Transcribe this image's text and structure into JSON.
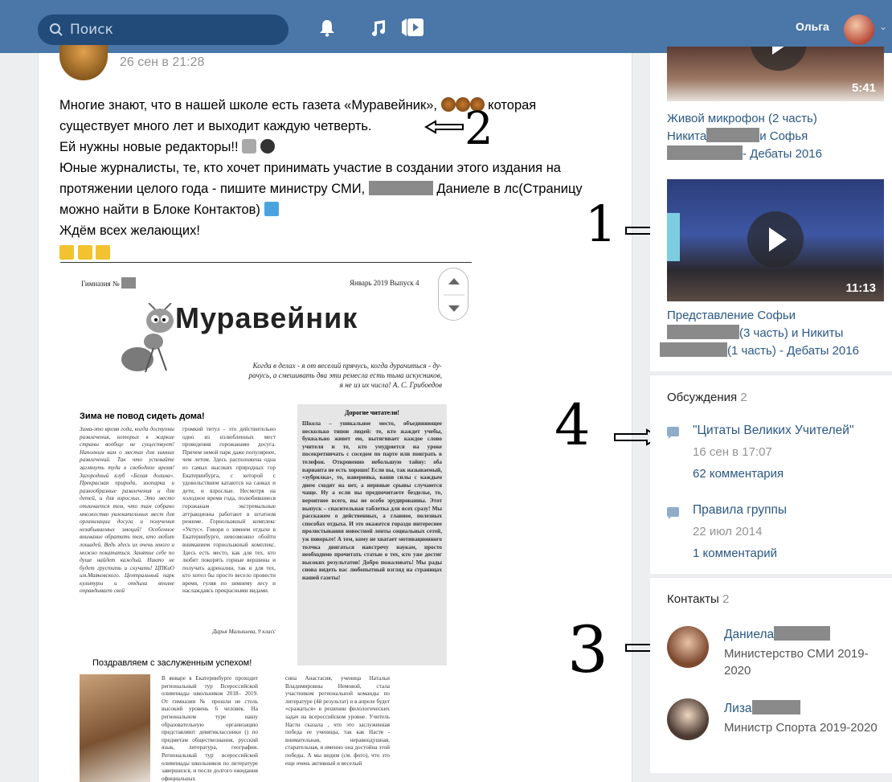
{
  "topbar": {
    "search_placeholder": "Поиск",
    "user_name": "Ольга"
  },
  "post": {
    "date": "26 сен в 21:28",
    "line1_a": "Многие знают, что в нашей школе есть газета «Муравейник»,",
    "line1_b": "которая",
    "line2": "существует много лет и выходит каждую четверть.",
    "line3": "Ей нужны новые редакторы!!",
    "line4": "Юные журналисты, те, кто хочет принимать участие в создании этого издания на",
    "line5_a": "протяжении целого года - пишите министру СМИ,",
    "line5_b": "Даниеле в лс(Страницу",
    "line6": "можно найти в Блоке Контактов)",
    "line7": "Ждём всех желающих!"
  },
  "newspaper": {
    "school": "Гимназия №",
    "issue": "Январь 2019 Выпуск 4",
    "title": "Муравейник",
    "motto1": "Когда в делах - я от веселий прячусь, когда дурачиться - ду-",
    "motto2": "рачусь, а смешивать два эти ремесла есть тьма искусников,",
    "motto3": "я не из их числа! А. С. Грибоедов",
    "article_title": "Зима не повод сидеть дома!",
    "article_col1": "Зима-это время года, когда доступны развлечения, которых в жаркие страны вообще не существует! Наполним вам о местах для зимних развлечений. Так что успевайте заглянуть туда в свободное время! Загородный клуб «Белая долина». Прекрасная природа, зоопарка и разнообразные развлечения и для детей, и для взрослых. Это место отличается тем, что там собрано множество увлекательных мест для организации досуга и получения незабываемых эмоций! Особенное внимание обратить тем, кто любит лошадей. Ведь здесь их очень много и можно покататься. Занятие себе по душе найдет каждый. Никто не будет грустить и скучать! ЦПКиО им.Маяковского. Центральный парк культуры и отдыха вполне оправдывает свой",
    "article_col2": "громкий титул – это действительно одно из излюбленных мест проведения горожанами досуга. Причем зимой парк даже популярнее, чем летом. Здесь расположена одна из самых высоких природных гор Екатеринбурга, с которой с удовольствием катаются на санках и дети, и взрослые. Несмотря на холодное время года, полюбившиеся горожанам экстремальные аттракционы работают в штатном режиме. Горнолыжный комплекс «Уктус». Говоря о зимнем отдыхе в Екатеринбурге, невозможно обойти вниманием горнолыжный комплекс. Здесь есть место, как для тех, кто любит покорять горные вершины и получать адреналин, так и для тех, кто хотел бы просто весело провести время, гуляя по зимнему лесу и наслаждаясь прекрасными видами.",
    "article_author": "Дарья Малышева, 9 класс",
    "readers_title": "Дорогие читатели!",
    "readers_text": "Школа – уникальное место, объединяющее несколько типов людей: те, кто жаждет учебы, буквально живет ею, вытягивает каждое слово учителя и те, кто умудряется на уроке посекретничать с соседом по парте или поиграть в телефон. Откровенно небольшую тайну: оба варианта не есть хорошо! Если вы, так называемый, «зубрилка», то, наверняка, ваши силы с каждым днем сходят на нет, а нервные срывы случаются чаще. Ну а если вы предпочитаете безделье, то, вероятнее всего, вы не особо эрудированны. Этот выпуск – спасительная таблетка для всех сразу! Мы расскажем о действенных, а главное, полезных способах отдыха. И это окажется гораздо интереснее пролистывания новостной ленты социальных сетей, уж поверьте! А тем, кому не хватает мотивационного толчка двигаться навстречу наукам, просто необходимо прочитать статью о тех, кто уже достиг высоких результатов! Добро пожаловать! Мы рады снова видеть вас любопытный взгляд на страницах нашей газеты!",
    "congrats_title": "Поздравляем с заслуженным успехом!",
    "congrats_col1": "В январе в Екатеринбурге проходит региональный тур Всероссийской олимпиады школьников 2018– 2019. От гимназии № прошли не столь высокий уровень 6 человек. На региональном туре нашу образовательную организацию представляют девятиклассники () по предметам обществознания, русский язык, литература, география. Региональный тур всероссийской олимпиады школьников по литературе завершился, и после долгого ожидания официальных",
    "congrats_col2": "сина Анастасия, ученица Натальи Владимировны Немовой, стала участником региональной команды по литературе (4й результат) и в апреле будет «сражаться» в решении филологических задач на всероссийском уровне. Учитель Насти сказала , что это заслуженная победа ее ученицы, так как Настя - внимательная, неравнодушная, старательная, и именно она достойна этой победы. А мы видим (см. фото), что это еще очень активный и веселый"
  },
  "sidebar": {
    "video1": {
      "duration": "5:41",
      "title_line1": "Живой микрофон (2 часть)",
      "title_line2_a": "Никита",
      "title_line2_b": "и Софья",
      "title_line3": "- Дебаты 2016"
    },
    "video2": {
      "duration": "11:13",
      "title_line1": "Представление Софьи",
      "title_line2": "(3 часть) и Никиты",
      "title_line3": "(1 часть) - Дебаты 2016"
    },
    "discussions": {
      "title": "Обсуждения",
      "count": "2",
      "topics": [
        {
          "name": "\"Цитаты Великих Учителей\"",
          "date": "16 сен в 17:07",
          "comments": "62 комментария"
        },
        {
          "name": "Правила группы",
          "date": "22 июл 2014",
          "comments": "1 комментарий"
        }
      ]
    },
    "contacts": {
      "title": "Контакты",
      "count": "2",
      "items": [
        {
          "name": "Даниела",
          "role": "Министерство СМИ 2019-2020"
        },
        {
          "name": "Лиза",
          "role": "Министр Спорта 2019-2020"
        }
      ]
    }
  },
  "annotations": {
    "one": "1",
    "two": "2",
    "three": "3",
    "four": "4"
  }
}
